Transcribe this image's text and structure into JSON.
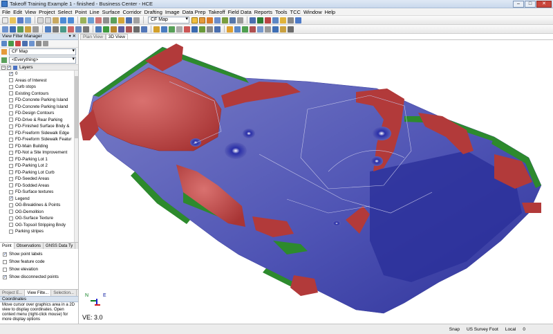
{
  "window": {
    "title": "Takeoff Training Example 1 - finished - Business Center - HCE",
    "minimize": "–",
    "maximize": "□",
    "close": "✕"
  },
  "menu": {
    "items": [
      "File",
      "Edit",
      "View",
      "Project",
      "Select",
      "Point",
      "Line",
      "Surface",
      "Corridor",
      "Drafting",
      "Image",
      "Data Prep",
      "Takeoff",
      "Field Data",
      "Reports",
      "Tools",
      "TCC",
      "Window",
      "Help"
    ]
  },
  "toolbar": {
    "map_combo": "CF Map"
  },
  "view_filter_manager": {
    "title": "View Filter Manager",
    "pin": "▾ ✕",
    "filter_value": "CF Map",
    "scope_value": "<Everything>",
    "layers_label": "Layers",
    "layers": [
      {
        "name": "0",
        "checked": true
      },
      {
        "name": "Areas of Interest",
        "checked": false
      },
      {
        "name": "Curb stops",
        "checked": false
      },
      {
        "name": "Existing Contours",
        "checked": false
      },
      {
        "name": "FD-Concrete Parking Island",
        "checked": false
      },
      {
        "name": "FD-Concrete Parking Island",
        "checked": false
      },
      {
        "name": "FD-Design Contours",
        "checked": false
      },
      {
        "name": "FD-Drive & Rear Parking",
        "checked": false
      },
      {
        "name": "FD-Finished Surface Bndy &",
        "checked": false
      },
      {
        "name": "FD-Freeform Sidewalk Edge",
        "checked": false
      },
      {
        "name": "FD-Freeform Sidewalk Featur",
        "checked": false
      },
      {
        "name": "FD-Main Building",
        "checked": false
      },
      {
        "name": "FD-Not a Site Improvement",
        "checked": false
      },
      {
        "name": "FD-Parking Lot 1",
        "checked": false
      },
      {
        "name": "FD-Parking Lot 2",
        "checked": false
      },
      {
        "name": "FD-Parking Lot Curb",
        "checked": false
      },
      {
        "name": "FD-Seeded Areas",
        "checked": false
      },
      {
        "name": "FD-Sodded Areas",
        "checked": false
      },
      {
        "name": "FD-Surface textures",
        "checked": false
      },
      {
        "name": "Legend",
        "checked": true
      },
      {
        "name": "OG-Breaklines & Points",
        "checked": false
      },
      {
        "name": "OG-Demolition",
        "checked": false
      },
      {
        "name": "OG-Surface Texture",
        "checked": false
      },
      {
        "name": "OG-Topsoil Stripping Bndy",
        "checked": false
      },
      {
        "name": "Parking stripes",
        "checked": false
      }
    ]
  },
  "option_tabs": [
    "Point",
    "Observations",
    "GNSS Data Ty"
  ],
  "point_options": [
    {
      "label": "Show point labels",
      "checked": true
    },
    {
      "label": "Show feature code",
      "checked": false
    },
    {
      "label": "Show elevation",
      "checked": false
    },
    {
      "label": "Show disconnected points",
      "checked": true
    }
  ],
  "bottom_tabs": [
    "Project E...",
    "View Filte...",
    "Selection..."
  ],
  "coordinates": {
    "title": "Coordinates",
    "text": "Move cursor over graphics area in a 2D view to display coordinates. Open context menu (right-click mouse) for more display options"
  },
  "view": {
    "tabs": [
      "Plan View",
      "3D View"
    ],
    "ve_label": "VE: 3.0",
    "axis_n": "N",
    "axis_e": "E"
  },
  "status": {
    "snap": "Snap",
    "units": "US Survey Foot",
    "local": "Local",
    "counter": "0"
  },
  "colors": {
    "cut": "#b23a3a",
    "fill": "#3b3fa8",
    "grade": "#2d8a2d"
  }
}
